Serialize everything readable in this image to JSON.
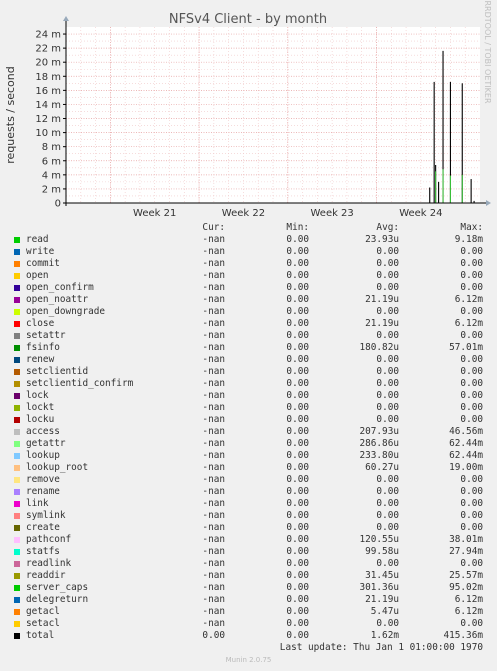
{
  "chart_data": {
    "type": "line",
    "title": "NFSv4 Client - by month",
    "ylabel": "requests / second",
    "ylim": [
      0,
      25
    ],
    "yticks": [
      "0",
      "2 m",
      "4 m",
      "6 m",
      "8 m",
      "10 m",
      "12 m",
      "14 m",
      "16 m",
      "18 m",
      "20 m",
      "22 m",
      "24 m"
    ],
    "ytick_values": [
      0,
      2,
      4,
      6,
      8,
      10,
      12,
      14,
      16,
      18,
      20,
      22,
      24
    ],
    "xlim": [
      0,
      28
    ],
    "xticks": [
      "Week 21",
      "Week 22",
      "Week 23",
      "Week 24"
    ],
    "xtick_values": [
      6,
      12,
      18,
      24
    ],
    "grid": true,
    "watermark": "RRDTOOL / TOBI OETIKER",
    "series": [
      {
        "name": "total",
        "color": "#000000",
        "x": [
          24.6,
          24.9,
          25.0,
          25.2,
          25.5,
          26.0,
          26.8,
          27.4,
          27.6
        ],
        "y": [
          2.2,
          17.2,
          5.4,
          3.0,
          21.6,
          17.2,
          17.0,
          3.4,
          0.3
        ]
      },
      {
        "name": "getattr",
        "color": "#3dcc3d",
        "x": [
          25.0,
          25.5,
          26.0,
          26.8
        ],
        "y": [
          4.5,
          4.8,
          3.9,
          4.0
        ]
      }
    ]
  },
  "legend": {
    "headers": [
      "Cur:",
      "Min:",
      "Avg:",
      "Max:"
    ],
    "rows": [
      {
        "name": "read",
        "color": "#00cc00",
        "cur": "-nan",
        "min": "0.00",
        "avg": "23.93u",
        "max": "9.18m"
      },
      {
        "name": "write",
        "color": "#0066b3",
        "cur": "-nan",
        "min": "0.00",
        "avg": "0.00",
        "max": "0.00"
      },
      {
        "name": "commit",
        "color": "#ff8000",
        "cur": "-nan",
        "min": "0.00",
        "avg": "0.00",
        "max": "0.00"
      },
      {
        "name": "open",
        "color": "#ffcc00",
        "cur": "-nan",
        "min": "0.00",
        "avg": "0.00",
        "max": "0.00"
      },
      {
        "name": "open_confirm",
        "color": "#330099",
        "cur": "-nan",
        "min": "0.00",
        "avg": "0.00",
        "max": "0.00"
      },
      {
        "name": "open_noattr",
        "color": "#990099",
        "cur": "-nan",
        "min": "0.00",
        "avg": "21.19u",
        "max": "6.12m"
      },
      {
        "name": "open_downgrade",
        "color": "#ccff00",
        "cur": "-nan",
        "min": "0.00",
        "avg": "0.00",
        "max": "0.00"
      },
      {
        "name": "close",
        "color": "#ff0000",
        "cur": "-nan",
        "min": "0.00",
        "avg": "21.19u",
        "max": "6.12m"
      },
      {
        "name": "setattr",
        "color": "#808080",
        "cur": "-nan",
        "min": "0.00",
        "avg": "0.00",
        "max": "0.00"
      },
      {
        "name": "fsinfo",
        "color": "#008f00",
        "cur": "-nan",
        "min": "0.00",
        "avg": "180.82u",
        "max": "57.01m"
      },
      {
        "name": "renew",
        "color": "#00487d",
        "cur": "-nan",
        "min": "0.00",
        "avg": "0.00",
        "max": "0.00"
      },
      {
        "name": "setclientid",
        "color": "#b35a00",
        "cur": "-nan",
        "min": "0.00",
        "avg": "0.00",
        "max": "0.00"
      },
      {
        "name": "setclientid_confirm",
        "color": "#b38f00",
        "cur": "-nan",
        "min": "0.00",
        "avg": "0.00",
        "max": "0.00"
      },
      {
        "name": "lock",
        "color": "#6b006b",
        "cur": "-nan",
        "min": "0.00",
        "avg": "0.00",
        "max": "0.00"
      },
      {
        "name": "lockt",
        "color": "#8fb300",
        "cur": "-nan",
        "min": "0.00",
        "avg": "0.00",
        "max": "0.00"
      },
      {
        "name": "locku",
        "color": "#b30000",
        "cur": "-nan",
        "min": "0.00",
        "avg": "0.00",
        "max": "0.00"
      },
      {
        "name": "access",
        "color": "#bebebe",
        "cur": "-nan",
        "min": "0.00",
        "avg": "207.93u",
        "max": "46.56m"
      },
      {
        "name": "getattr",
        "color": "#80ff80",
        "cur": "-nan",
        "min": "0.00",
        "avg": "286.86u",
        "max": "62.44m"
      },
      {
        "name": "lookup",
        "color": "#80c9ff",
        "cur": "-nan",
        "min": "0.00",
        "avg": "233.80u",
        "max": "62.44m"
      },
      {
        "name": "lookup_root",
        "color": "#ffc080",
        "cur": "-nan",
        "min": "0.00",
        "avg": "60.27u",
        "max": "19.00m"
      },
      {
        "name": "remove",
        "color": "#ffe680",
        "cur": "-nan",
        "min": "0.00",
        "avg": "0.00",
        "max": "0.00"
      },
      {
        "name": "rename",
        "color": "#aa80ff",
        "cur": "-nan",
        "min": "0.00",
        "avg": "0.00",
        "max": "0.00"
      },
      {
        "name": "link",
        "color": "#ee00cc",
        "cur": "-nan",
        "min": "0.00",
        "avg": "0.00",
        "max": "0.00"
      },
      {
        "name": "symlink",
        "color": "#ff8080",
        "cur": "-nan",
        "min": "0.00",
        "avg": "0.00",
        "max": "0.00"
      },
      {
        "name": "create",
        "color": "#666600",
        "cur": "-nan",
        "min": "0.00",
        "avg": "0.00",
        "max": "0.00"
      },
      {
        "name": "pathconf",
        "color": "#ffbfff",
        "cur": "-nan",
        "min": "0.00",
        "avg": "120.55u",
        "max": "38.01m"
      },
      {
        "name": "statfs",
        "color": "#00ffcc",
        "cur": "-nan",
        "min": "0.00",
        "avg": "99.58u",
        "max": "27.94m"
      },
      {
        "name": "readlink",
        "color": "#cc6699",
        "cur": "-nan",
        "min": "0.00",
        "avg": "0.00",
        "max": "0.00"
      },
      {
        "name": "readdir",
        "color": "#999900",
        "cur": "-nan",
        "min": "0.00",
        "avg": "31.45u",
        "max": "25.57m"
      },
      {
        "name": "server_caps",
        "color": "#00cc00",
        "cur": "-nan",
        "min": "0.00",
        "avg": "301.36u",
        "max": "95.02m"
      },
      {
        "name": "delegreturn",
        "color": "#0066b3",
        "cur": "-nan",
        "min": "0.00",
        "avg": "21.19u",
        "max": "6.12m"
      },
      {
        "name": "getacl",
        "color": "#ff8000",
        "cur": "-nan",
        "min": "0.00",
        "avg": "5.47u",
        "max": "6.12m"
      },
      {
        "name": "setacl",
        "color": "#ffcc00",
        "cur": "-nan",
        "min": "0.00",
        "avg": "0.00",
        "max": "0.00"
      },
      {
        "name": "total",
        "color": "#000000",
        "cur": "0.00",
        "min": "0.00",
        "avg": "1.62m",
        "max": "415.36m"
      }
    ]
  },
  "last_update": "Last update: Thu Jan  1 01:00:00 1970",
  "footer": "Munin 2.0.75"
}
